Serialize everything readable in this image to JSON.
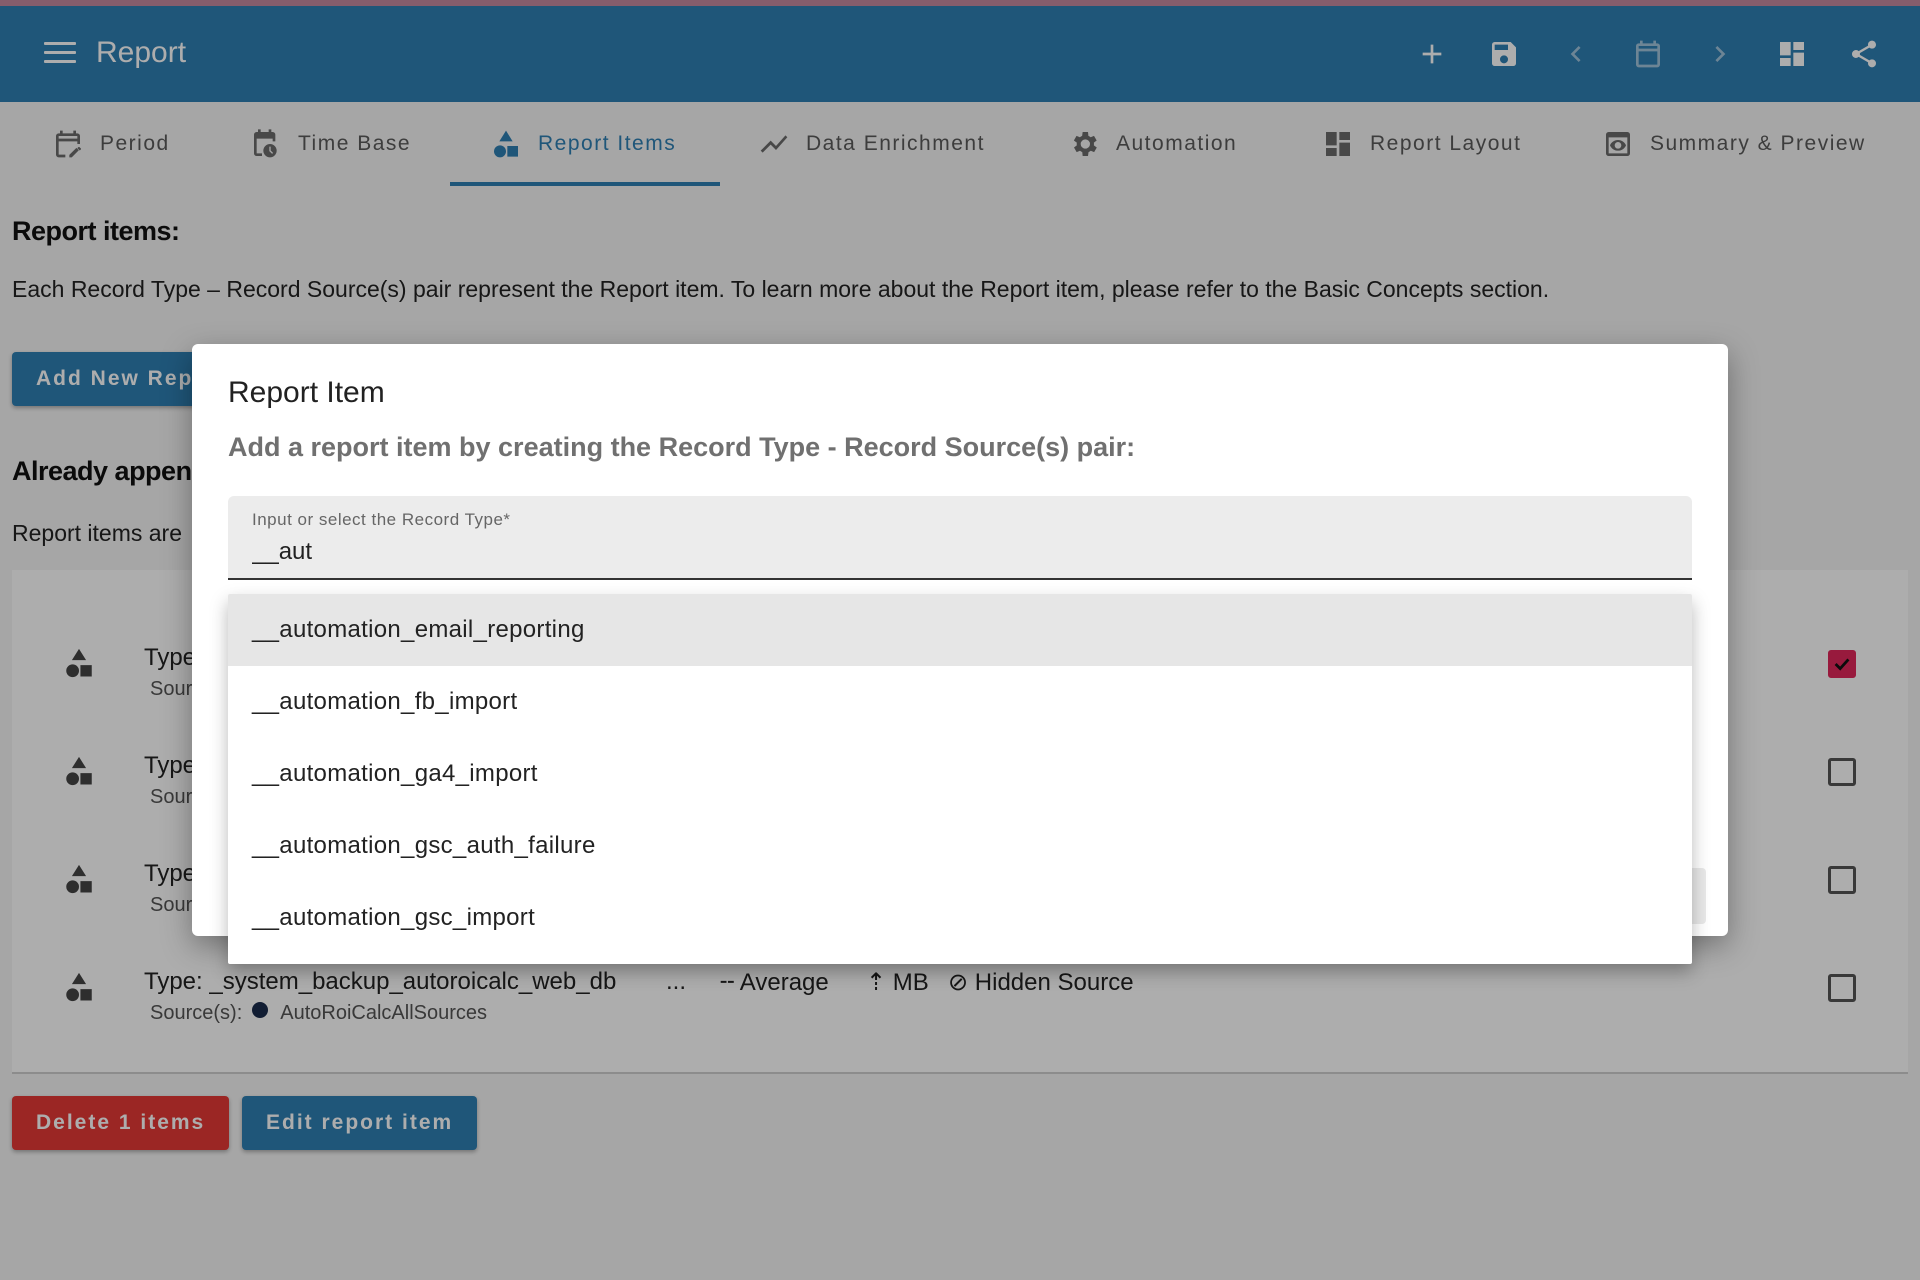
{
  "colors": {
    "primary": "#2f7fb3",
    "danger": "#e53935",
    "accent_check": "#e0275a",
    "top_stripe": "#c48aa0"
  },
  "appbar": {
    "title": "Report",
    "actions": [
      "plus-icon",
      "save-icon",
      "chevron-left-icon",
      "calendar-icon",
      "chevron-right-icon",
      "dashboard-icon",
      "share-icon"
    ]
  },
  "tabs": [
    {
      "label": "Period",
      "icon": "calendar-edit-icon"
    },
    {
      "label": "Time Base",
      "icon": "calendar-clock-icon"
    },
    {
      "label": "Report Items",
      "icon": "shapes-icon",
      "active": true
    },
    {
      "label": "Data Enrichment",
      "icon": "trend-line-icon"
    },
    {
      "label": "Automation",
      "icon": "gear-icon"
    },
    {
      "label": "Report Layout",
      "icon": "dashboard-icon"
    },
    {
      "label": "Summary & Preview",
      "icon": "eye-preview-icon"
    }
  ],
  "page": {
    "title": "Report items:",
    "description": "Each Record Type – Record Source(s) pair represent the Report item. To learn more about the Report item, please refer to the Basic Concepts section.",
    "add_button": "Add New Repo",
    "appended_title": "Already appen",
    "appended_desc": "Report items are"
  },
  "items": [
    {
      "type": "Type",
      "source": "Sour",
      "checked": true
    },
    {
      "type": "Type",
      "source": "Sour",
      "checked": false
    },
    {
      "type": "Type",
      "source": "Sour",
      "checked": false
    },
    {
      "type": "Type: _system_backup_autoroicalc_web_db",
      "ellipsis": "...",
      "aggregation": "Average",
      "unit": "MB",
      "visibility": "Hidden Source",
      "source_label": "Source(s):",
      "source": "AutoRoiCalcAllSources",
      "checked": false
    }
  ],
  "footer": {
    "delete_button": "Delete 1 items",
    "edit_button": "Edit report item"
  },
  "dialog": {
    "title": "Report Item",
    "subtitle": "Add a report item by creating the Record Type - Record Source(s) pair:",
    "field_label": "Input or select the Record Type*",
    "field_value": "__aut",
    "options": [
      "__automation_email_reporting",
      "__automation_fb_import",
      "__automation_ga4_import",
      "__automation_gsc_auth_failure",
      "__automation_gsc_import"
    ]
  }
}
